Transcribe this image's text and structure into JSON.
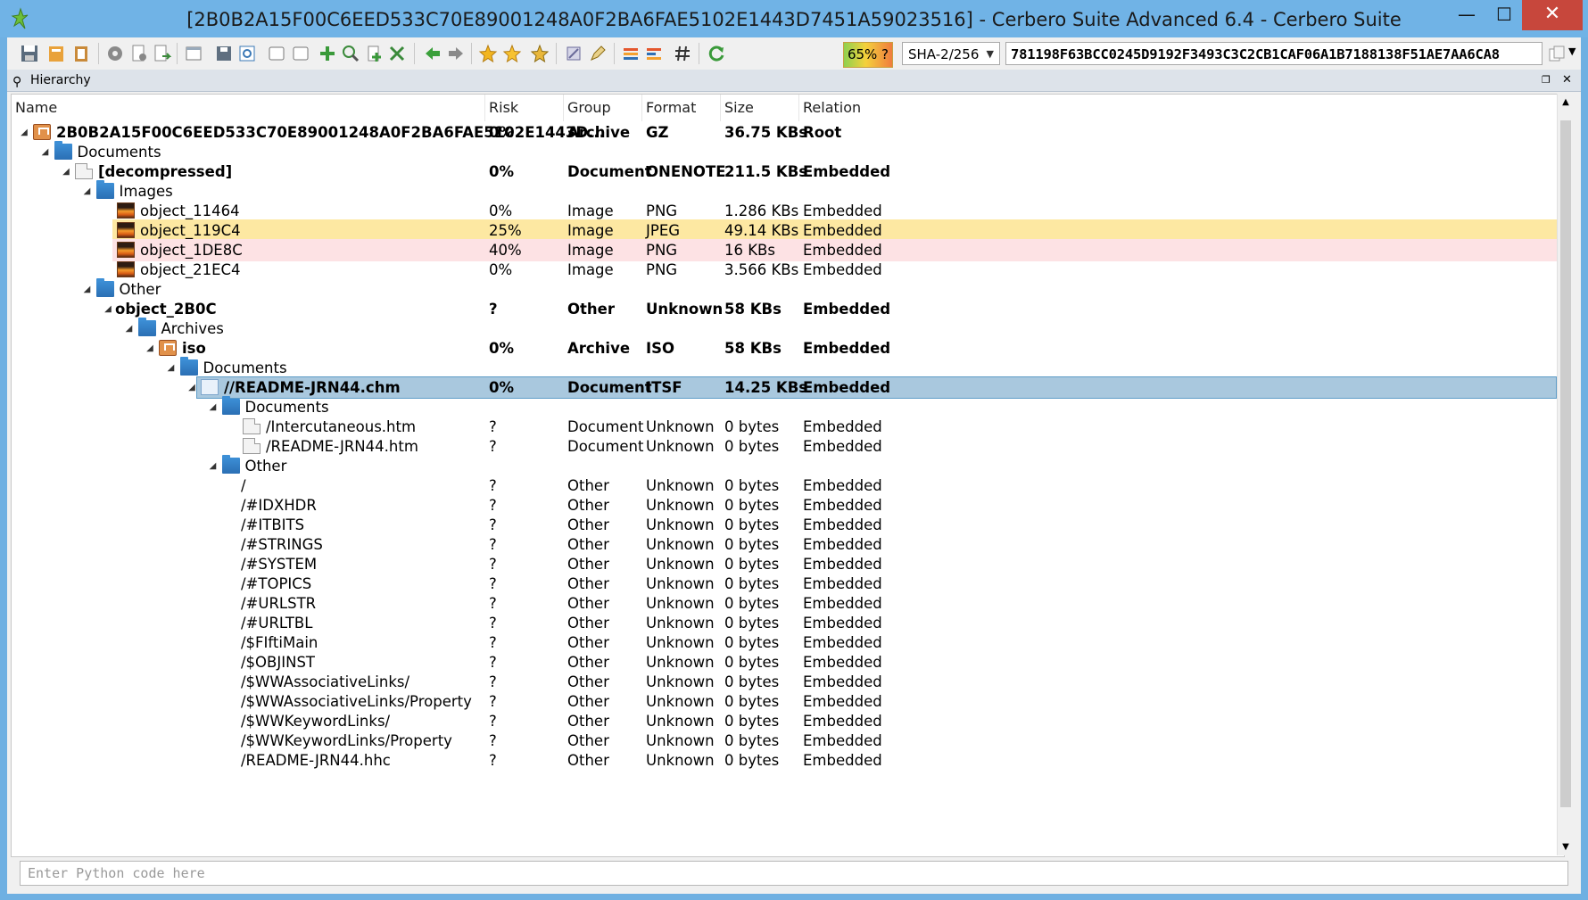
{
  "window": {
    "title": "[2B0B2A15F00C6EED533C70E89001248A0F2BA6FAE5102E1443D7451A59023516] - Cerbero Suite Advanced 6.4 - Cerbero Suite",
    "minimize_glyph": "—",
    "maximize_glyph": "☐",
    "close_glyph": "✕"
  },
  "toolbar": {
    "risk_badge": "65% ?",
    "hash_algorithm": "SHA-2/256",
    "hash_value": "781198F63BCC0245D9192F3493C3C2CB1CAF06A1B7188138F51AE7AA6CA8"
  },
  "panel": {
    "title": "Hierarchy"
  },
  "columns": [
    "Name",
    "Risk",
    "Group",
    "Format",
    "Size",
    "Relation"
  ],
  "rows": [
    {
      "name": "2B0B2A15F00C6EED533C70E89001248A0F2BA6FAE5102E1443D...",
      "risk": "0%",
      "group": "Archive",
      "format": "GZ",
      "size": "36.75 KBs",
      "relation": "Root",
      "bold": true
    },
    {
      "name": "Documents",
      "risk": "",
      "group": "",
      "format": "",
      "size": "",
      "relation": ""
    },
    {
      "name": "[decompressed]",
      "risk": "0%",
      "group": "Document",
      "format": "ONENOTE",
      "size": "211.5 KBs",
      "relation": "Embedded",
      "bold": true
    },
    {
      "name": "Images",
      "risk": "",
      "group": "",
      "format": "",
      "size": "",
      "relation": ""
    },
    {
      "name": "object_11464",
      "risk": "0%",
      "group": "Image",
      "format": "PNG",
      "size": "1.286 KBs",
      "relation": "Embedded"
    },
    {
      "name": "object_119C4",
      "risk": "25%",
      "group": "Image",
      "format": "JPEG",
      "size": "49.14 KBs",
      "relation": "Embedded"
    },
    {
      "name": "object_1DE8C",
      "risk": "40%",
      "group": "Image",
      "format": "PNG",
      "size": "16 KBs",
      "relation": "Embedded"
    },
    {
      "name": "object_21EC4",
      "risk": "0%",
      "group": "Image",
      "format": "PNG",
      "size": "3.566 KBs",
      "relation": "Embedded"
    },
    {
      "name": "Other",
      "risk": "",
      "group": "",
      "format": "",
      "size": "",
      "relation": ""
    },
    {
      "name": "object_2B0C",
      "risk": "?",
      "group": "Other",
      "format": "Unknown",
      "size": "58 KBs",
      "relation": "Embedded",
      "bold": true
    },
    {
      "name": "Archives",
      "risk": "",
      "group": "",
      "format": "",
      "size": "",
      "relation": ""
    },
    {
      "name": "iso",
      "risk": "0%",
      "group": "Archive",
      "format": "ISO",
      "size": "58 KBs",
      "relation": "Embedded",
      "bold": true
    },
    {
      "name": "Documents",
      "risk": "",
      "group": "",
      "format": "",
      "size": "",
      "relation": ""
    },
    {
      "name": "//README-JRN44.chm",
      "risk": "0%",
      "group": "Document",
      "format": "ITSF",
      "size": "14.25 KBs",
      "relation": "Embedded",
      "bold": true
    },
    {
      "name": "Documents",
      "risk": "",
      "group": "",
      "format": "",
      "size": "",
      "relation": ""
    },
    {
      "name": "/Intercutaneous.htm",
      "risk": "?",
      "group": "Document",
      "format": "Unknown",
      "size": "0 bytes",
      "relation": "Embedded"
    },
    {
      "name": "/README-JRN44.htm",
      "risk": "?",
      "group": "Document",
      "format": "Unknown",
      "size": "0 bytes",
      "relation": "Embedded"
    },
    {
      "name": "Other",
      "risk": "",
      "group": "",
      "format": "",
      "size": "",
      "relation": ""
    },
    {
      "name": "/",
      "risk": "?",
      "group": "Other",
      "format": "Unknown",
      "size": "0 bytes",
      "relation": "Embedded"
    },
    {
      "name": "/#IDXHDR",
      "risk": "?",
      "group": "Other",
      "format": "Unknown",
      "size": "0 bytes",
      "relation": "Embedded"
    },
    {
      "name": "/#ITBITS",
      "risk": "?",
      "group": "Other",
      "format": "Unknown",
      "size": "0 bytes",
      "relation": "Embedded"
    },
    {
      "name": "/#STRINGS",
      "risk": "?",
      "group": "Other",
      "format": "Unknown",
      "size": "0 bytes",
      "relation": "Embedded"
    },
    {
      "name": "/#SYSTEM",
      "risk": "?",
      "group": "Other",
      "format": "Unknown",
      "size": "0 bytes",
      "relation": "Embedded"
    },
    {
      "name": "/#TOPICS",
      "risk": "?",
      "group": "Other",
      "format": "Unknown",
      "size": "0 bytes",
      "relation": "Embedded"
    },
    {
      "name": "/#URLSTR",
      "risk": "?",
      "group": "Other",
      "format": "Unknown",
      "size": "0 bytes",
      "relation": "Embedded"
    },
    {
      "name": "/#URLTBL",
      "risk": "?",
      "group": "Other",
      "format": "Unknown",
      "size": "0 bytes",
      "relation": "Embedded"
    },
    {
      "name": "/$FIftiMain",
      "risk": "?",
      "group": "Other",
      "format": "Unknown",
      "size": "0 bytes",
      "relation": "Embedded"
    },
    {
      "name": "/$OBJINST",
      "risk": "?",
      "group": "Other",
      "format": "Unknown",
      "size": "0 bytes",
      "relation": "Embedded"
    },
    {
      "name": "/$WWAssociativeLinks/",
      "risk": "?",
      "group": "Other",
      "format": "Unknown",
      "size": "0 bytes",
      "relation": "Embedded"
    },
    {
      "name": "/$WWAssociativeLinks/Property",
      "risk": "?",
      "group": "Other",
      "format": "Unknown",
      "size": "0 bytes",
      "relation": "Embedded"
    },
    {
      "name": "/$WWKeywordLinks/",
      "risk": "?",
      "group": "Other",
      "format": "Unknown",
      "size": "0 bytes",
      "relation": "Embedded"
    },
    {
      "name": "/$WWKeywordLinks/Property",
      "risk": "?",
      "group": "Other",
      "format": "Unknown",
      "size": "0 bytes",
      "relation": "Embedded"
    },
    {
      "name": "/README-JRN44.hhc",
      "risk": "?",
      "group": "Other",
      "format": "Unknown",
      "size": "0 bytes",
      "relation": "Embedded"
    }
  ],
  "python_input": {
    "placeholder": "Enter Python code here"
  },
  "colors": {
    "title_bar": "#70b3e6",
    "close_button": "#c7473c",
    "highlight_yellow": "#fde8a2",
    "highlight_pink": "#fde2e4",
    "selection": "#a9c8de"
  }
}
